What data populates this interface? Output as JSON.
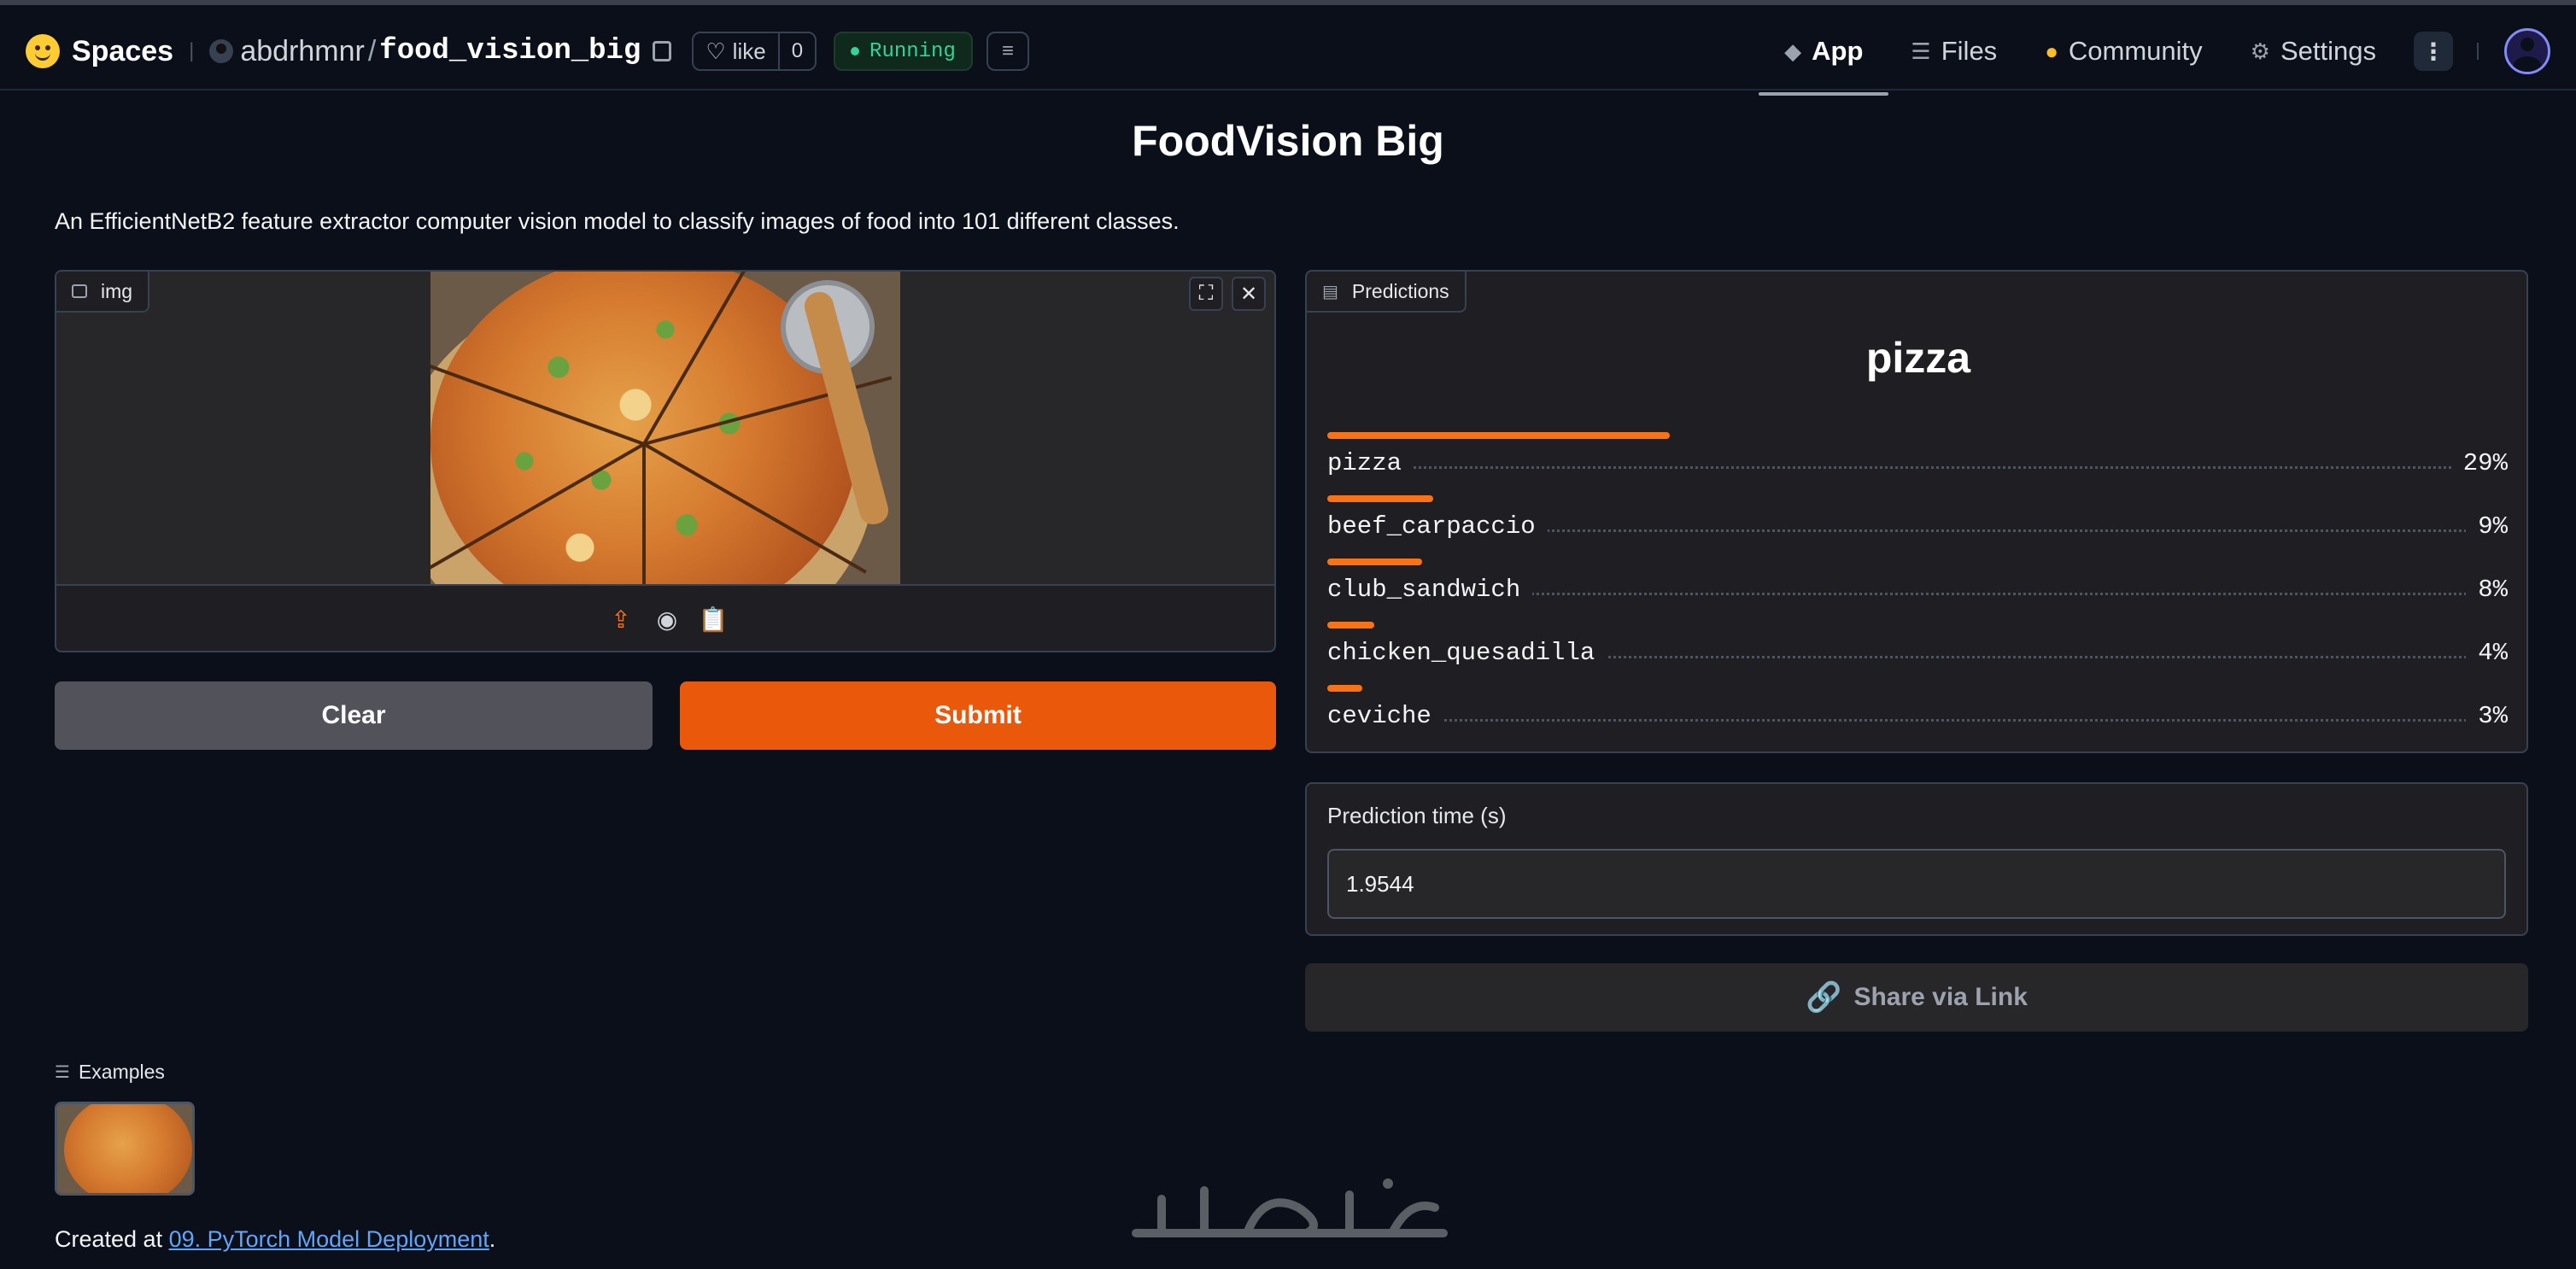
{
  "header": {
    "brand": "Spaces",
    "owner": "abdrhmnr",
    "separator": "/",
    "repo": "food_vision_big",
    "like_label": "like",
    "like_count": "0",
    "status": "Running",
    "tabs": [
      {
        "label": "App",
        "icon": "cube-icon",
        "active": true
      },
      {
        "label": "Files",
        "icon": "files-icon",
        "active": false
      },
      {
        "label": "Community",
        "icon": "community-icon",
        "active": false
      },
      {
        "label": "Settings",
        "icon": "gear-icon",
        "active": false
      }
    ]
  },
  "app": {
    "title": "FoodVision Big",
    "description": "An EfficientNetB2 feature extractor computer vision model to classify images of food into 101 different classes."
  },
  "input": {
    "label": "img",
    "image_alt": "pizza photo"
  },
  "buttons": {
    "clear": "Clear",
    "submit": "Submit",
    "share": "Share via Link"
  },
  "predictions": {
    "label": "Predictions",
    "top": "pizza",
    "items": [
      {
        "label": "pizza",
        "pct": "29%",
        "value": 0.29
      },
      {
        "label": "beef_carpaccio",
        "pct": "9%",
        "value": 0.09
      },
      {
        "label": "club_sandwich",
        "pct": "8%",
        "value": 0.08
      },
      {
        "label": "chicken_quesadilla",
        "pct": "4%",
        "value": 0.04
      },
      {
        "label": "ceviche",
        "pct": "3%",
        "value": 0.03
      }
    ]
  },
  "prediction_time": {
    "label": "Prediction time (s)",
    "value": "1.9544"
  },
  "examples": {
    "label": "Examples"
  },
  "footer": {
    "prefix": "Created at ",
    "link_text": "09. PyTorch Model Deployment",
    "suffix": "."
  },
  "colors": {
    "accent": "#ea580c",
    "bar": "#f97316",
    "running": "#34d399",
    "background": "#0b0f19"
  }
}
